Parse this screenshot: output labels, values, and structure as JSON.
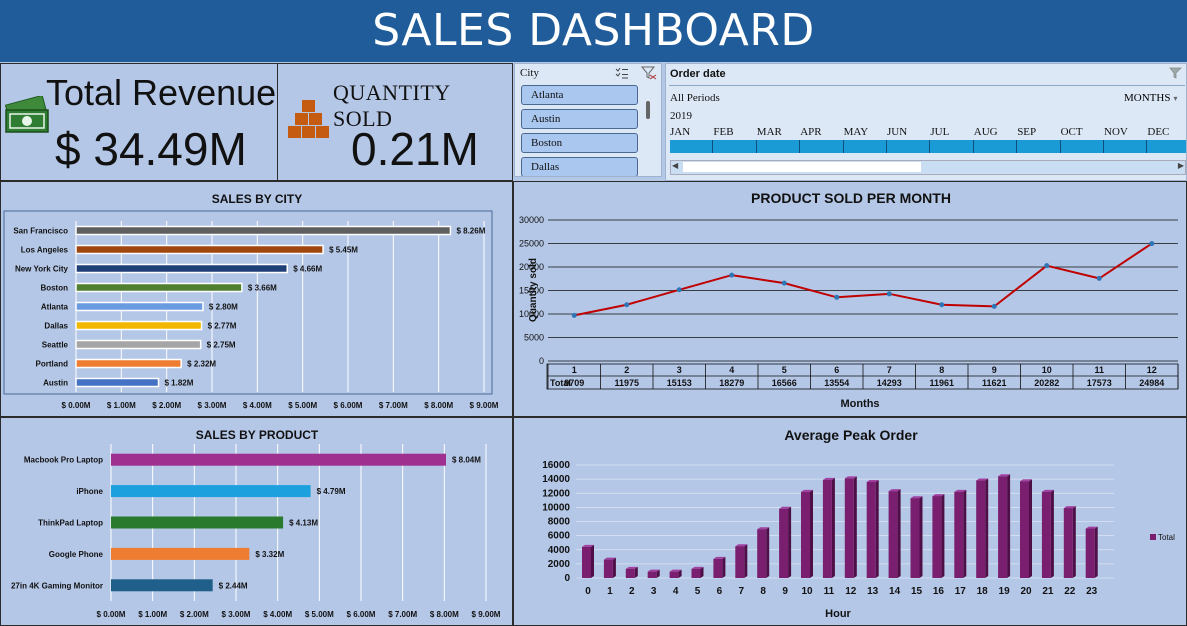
{
  "title": "SALES DASHBOARD",
  "kpis": {
    "revenue_label": "Total Revenue",
    "revenue_value": "$ 34.49M",
    "quantity_label": "QUANTITY SOLD",
    "quantity_value": "0.21M"
  },
  "icons": {
    "revenue": "cash-icon",
    "quantity": "boxes-icon",
    "multi_select": "multi-select-icon",
    "clear_filter": "clear-filter-icon"
  },
  "city_slicer": {
    "header": "City",
    "items": [
      "Atlanta",
      "Austin",
      "Boston",
      "Dallas"
    ]
  },
  "timeline": {
    "header": "Order date",
    "period": "All Periods",
    "level": "MONTHS",
    "year": "2019",
    "months": [
      "JAN",
      "FEB",
      "MAR",
      "APR",
      "MAY",
      "JUN",
      "JUL",
      "AUG",
      "SEP",
      "OCT",
      "NOV",
      "DEC"
    ]
  },
  "colors": {
    "title_bar": "#1f5c99",
    "panel_bg": "#b4c7e7",
    "line": "#c00000",
    "column": "#7a1f6f",
    "timeline_bar": "#1b9bd6"
  },
  "chart_data": [
    {
      "type": "bar",
      "title": "SALES BY CITY",
      "categories": [
        "San Francisco",
        "Los Angeles",
        "New York City",
        "Boston",
        "Atlanta",
        "Dallas",
        "Seattle",
        "Portland",
        "Austin"
      ],
      "values": [
        8.26,
        5.45,
        4.66,
        3.66,
        2.8,
        2.77,
        2.75,
        2.32,
        1.82
      ],
      "data_labels": [
        "$ 8.26M",
        "$ 5.45M",
        "$ 4.66M",
        "$ 3.66M",
        "$ 2.80M",
        "$ 2.77M",
        "$ 2.75M",
        "$ 2.32M",
        "$ 1.82M"
      ],
      "bar_colors": [
        "#5f5f5f",
        "#a0470f",
        "#1f3f77",
        "#4f7f2f",
        "#6a9be0",
        "#f2b800",
        "#a5a5a5",
        "#ef7d31",
        "#4472c4"
      ],
      "xlim": [
        0,
        9
      ],
      "tick_labels": [
        "$ 0.00M",
        "$ 1.00M",
        "$ 2.00M",
        "$ 3.00M",
        "$ 4.00M",
        "$ 5.00M",
        "$ 6.00M",
        "$ 7.00M",
        "$ 8.00M",
        "$ 9.00M"
      ],
      "grid": true
    },
    {
      "type": "line",
      "title": "PRODUCT SOLD PER MONTH",
      "xlabel": "Months",
      "ylabel": "Quantity sold",
      "x": [
        "1",
        "2",
        "3",
        "4",
        "5",
        "6",
        "7",
        "8",
        "9",
        "10",
        "11",
        "12"
      ],
      "series": [
        {
          "name": "Total",
          "values": [
            9709,
            11975,
            15153,
            18279,
            16566,
            13554,
            14293,
            11961,
            11621,
            20282,
            17573,
            24984
          ]
        }
      ],
      "ylim": [
        0,
        30000
      ],
      "yticks": [
        "0",
        "5000",
        "10000",
        "15000",
        "20000",
        "25000",
        "30000"
      ],
      "grid": true,
      "data_table": true
    },
    {
      "type": "bar",
      "title": "SALES BY PRODUCT",
      "categories": [
        "Macbook Pro Laptop",
        "iPhone",
        "ThinkPad Laptop",
        "Google Phone",
        "27in 4K Gaming Monitor"
      ],
      "values": [
        8.04,
        4.79,
        4.13,
        3.32,
        2.44
      ],
      "data_labels": [
        "$ 8.04M",
        "$ 4.79M",
        "$ 4.13M",
        "$ 3.32M",
        "$ 2.44M"
      ],
      "bar_colors": [
        "#a0308f",
        "#1da1de",
        "#2a7a2e",
        "#ef7d31",
        "#1f5f8a"
      ],
      "xlim": [
        0,
        9
      ],
      "tick_labels": [
        "$ 0.00M",
        "$ 1.00M",
        "$ 2.00M",
        "$ 3.00M",
        "$ 4.00M",
        "$ 5.00M",
        "$ 6.00M",
        "$ 7.00M",
        "$ 8.00M",
        "$ 9.00M"
      ],
      "grid": true
    },
    {
      "type": "bar",
      "title": "Average Peak Order",
      "xlabel": "Hour",
      "categories": [
        "0",
        "1",
        "2",
        "3",
        "4",
        "5",
        "6",
        "7",
        "8",
        "9",
        "10",
        "11",
        "12",
        "13",
        "14",
        "15",
        "16",
        "17",
        "18",
        "19",
        "20",
        "21",
        "22",
        "23"
      ],
      "series": [
        {
          "name": "Total",
          "values": [
            4400,
            2600,
            1300,
            900,
            900,
            1300,
            2700,
            4500,
            6900,
            9800,
            12200,
            13900,
            14100,
            13600,
            12300,
            11300,
            11600,
            12200,
            13800,
            14400,
            13700,
            12200,
            9900,
            7000
          ]
        }
      ],
      "ylim": [
        0,
        16000
      ],
      "yticks": [
        "0",
        "2000",
        "4000",
        "6000",
        "8000",
        "10000",
        "12000",
        "14000",
        "16000"
      ],
      "legend": "right",
      "grid": true
    }
  ]
}
